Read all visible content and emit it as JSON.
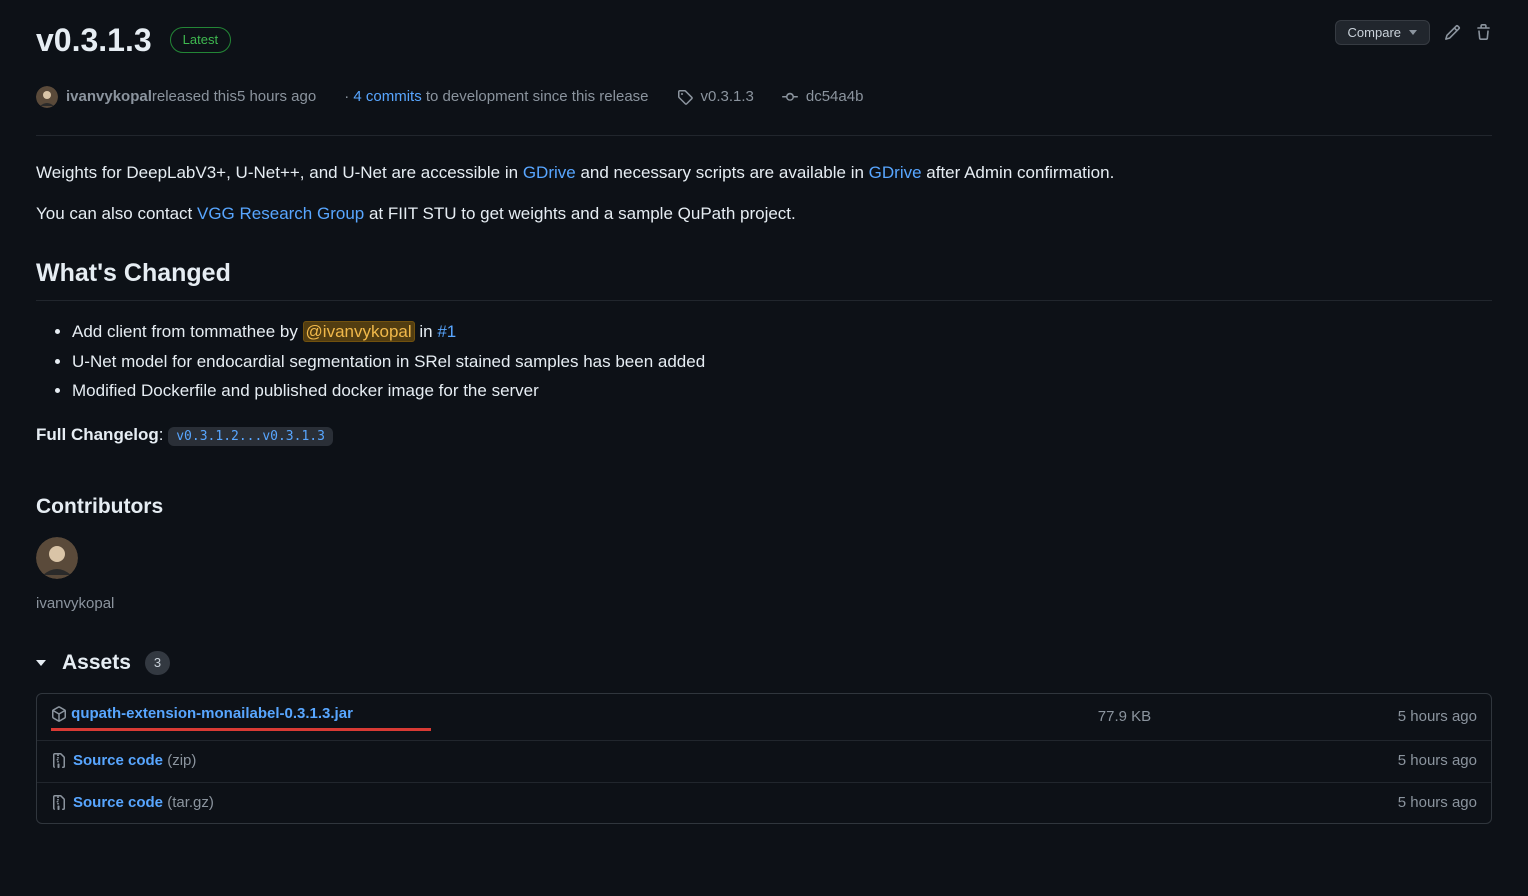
{
  "release": {
    "title": "v0.3.1.3",
    "latest_badge": "Latest"
  },
  "actions": {
    "compare_label": "Compare"
  },
  "meta": {
    "author": "ivanvykopal",
    "author_suffix": " released this ",
    "timeago": "5 hours ago",
    "commits_prefix": "· ",
    "commits_link": "4 commits",
    "commits_suffix": " to development since this release",
    "tag": "v0.3.1.3",
    "sha": "dc54a4b"
  },
  "body": {
    "p1_a": "Weights for DeepLabV3+, U-Net++, and U-Net are accessible in ",
    "p1_link1": "GDrive",
    "p1_b": " and necessary scripts are available in ",
    "p1_link2": "GDrive",
    "p1_c": " after Admin confirmation.",
    "p2_a": "You can also contact ",
    "p2_link": "VGG Research Group",
    "p2_b": " at FIIT STU to get weights and a sample QuPath project.",
    "h2": "What's Changed",
    "items": {
      "i1_a": "Add client from tommathee by ",
      "i1_mention": "@ivanvykopal",
      "i1_b": " in ",
      "i1_link": "#1",
      "i2": "U-Net model for endocardial segmentation in SRel stained samples has been added",
      "i3": "Modified Dockerfile and published docker image for the server"
    },
    "changelog_label": "Full Changelog",
    "changelog_colon": ": ",
    "changelog_code": "v0.3.1.2...v0.3.1.3"
  },
  "contributors": {
    "heading": "Contributors",
    "name": "ivanvykopal"
  },
  "assets": {
    "heading": "Assets",
    "count": "3",
    "rows": [
      {
        "name": "qupath-extension-monailabel-0.3.1.3.jar",
        "ext": "",
        "size": "77.9 KB",
        "time": "5 hours ago",
        "icon": "cube",
        "underline": true
      },
      {
        "name": "Source code",
        "ext": " (zip)",
        "size": "",
        "time": "5 hours ago",
        "icon": "zip",
        "underline": false
      },
      {
        "name": "Source code",
        "ext": " (tar.gz)",
        "size": "",
        "time": "5 hours ago",
        "icon": "zip",
        "underline": false
      }
    ]
  }
}
